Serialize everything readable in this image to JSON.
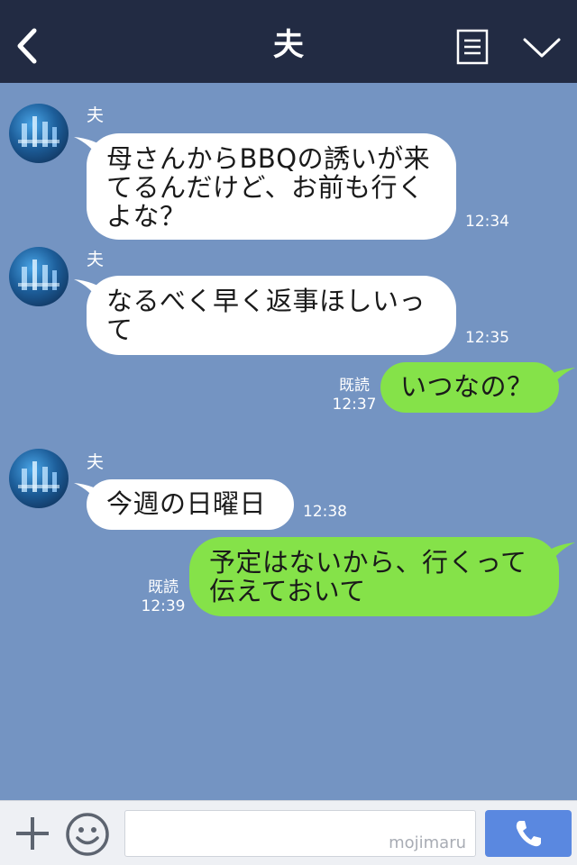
{
  "header": {
    "title": "夫",
    "back_icon": "chevron-left-icon",
    "menu_icon": "list-icon",
    "collapse_icon": "chevron-down-icon",
    "background_color": "#222b43"
  },
  "chat": {
    "background_color": "#7494c2",
    "incoming_bubble_color": "#ffffff",
    "outgoing_bubble_color": "#85e249",
    "messages": [
      {
        "direction": "in",
        "sender": "夫",
        "text": "母さんからBBQの誘いが来てるんだけど、お前も行くよな？",
        "time": "12:34"
      },
      {
        "direction": "in",
        "sender": "夫",
        "text": "なるべく早く返事ほしいって",
        "time": "12:35"
      },
      {
        "direction": "out",
        "text": "いつなの？",
        "read": "既読",
        "time": "12:37"
      },
      {
        "direction": "in",
        "sender": "夫",
        "text": "今週の日曜日",
        "time": "12:38"
      },
      {
        "direction": "out",
        "text": "予定はないから、行くって伝えておいて",
        "read": "既読",
        "time": "12:39"
      }
    ]
  },
  "footer": {
    "plus_icon": "plus-icon",
    "emoji_icon": "smiley-icon",
    "input_value": "",
    "watermark": "mojimaru",
    "call_icon": "phone-icon",
    "call_button_color": "#5a88e0"
  }
}
